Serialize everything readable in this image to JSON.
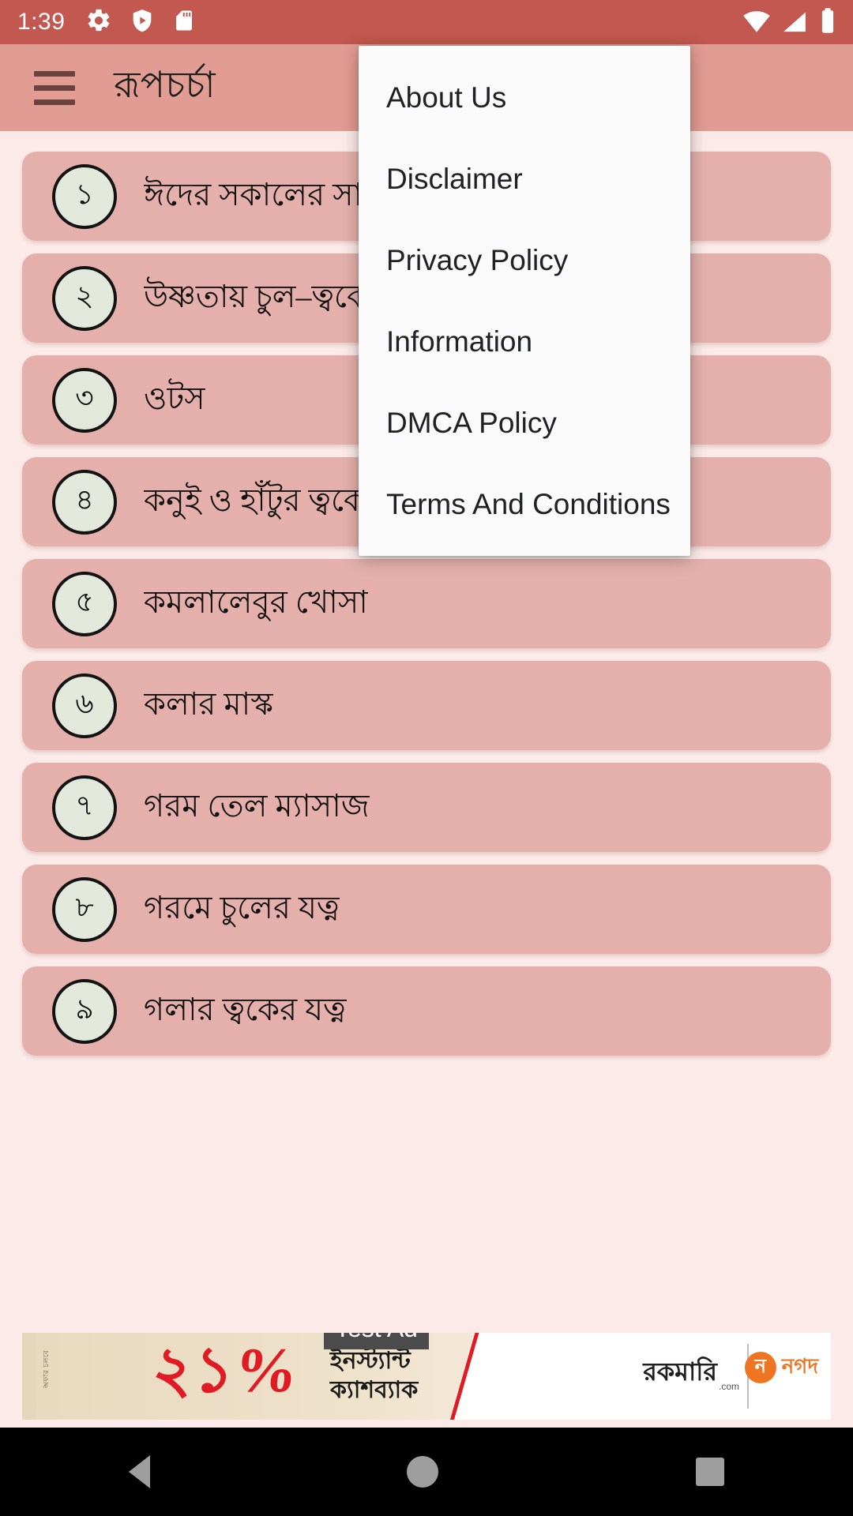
{
  "status_bar": {
    "time": "1:39",
    "icons": [
      "gear-icon",
      "shield-play-icon",
      "sd-card-icon",
      "wifi-icon",
      "signal-icon",
      "battery-icon"
    ]
  },
  "app_bar": {
    "menu_icon": "hamburger-icon",
    "title": "রূপচর্চা"
  },
  "overflow_menu": {
    "items": [
      {
        "label": "About Us"
      },
      {
        "label": "Disclaimer"
      },
      {
        "label": "Privacy Policy"
      },
      {
        "label": "Information"
      },
      {
        "label": "DMCA Policy"
      },
      {
        "label": "Terms And Conditions"
      }
    ]
  },
  "list": {
    "items": [
      {
        "number": "১",
        "label": "ঈদের সকালের সাজ"
      },
      {
        "number": "২",
        "label": "উষ্ণতায় চুল–ত্বকের যত্ন"
      },
      {
        "number": "৩",
        "label": "ওটস"
      },
      {
        "number": "৪",
        "label": "কনুই ও হাঁটুর ত্বকের যত্ন"
      },
      {
        "number": "৫",
        "label": "কমলালেবুর খোসা"
      },
      {
        "number": "৬",
        "label": "কলার মাস্ক"
      },
      {
        "number": "৭",
        "label": "গরম তেল ম্যাসাজ"
      },
      {
        "number": "৮",
        "label": "গরমে চুলের যত্ন"
      },
      {
        "number": "৯",
        "label": "গলার ত্বকের যত্ন"
      }
    ]
  },
  "ad": {
    "badge": "Test Ad",
    "percent": "২১%",
    "cashback_line1": "ইনস্ট্যান্ট",
    "cashback_line2": "ক্যাশব্যাক",
    "vertical_text": "অফার চলবে",
    "brand": "রকমারি",
    "brand_domain": ".com",
    "partner_mark": "ন",
    "partner_name": "নগদ",
    "info_icon": "ad-info-icon",
    "close_icon": "ad-close-icon"
  },
  "nav_bar": {
    "back": "back-triangle-icon",
    "home": "home-circle-icon",
    "recent": "recent-square-icon"
  },
  "colors": {
    "status_bar": "#C2584F",
    "app_bar": "#E19C93",
    "page_bg": "#FBEAE8",
    "card": "#E5B0AB",
    "circle": "#E2E8DC",
    "menu_bg": "#FAFAFA"
  }
}
